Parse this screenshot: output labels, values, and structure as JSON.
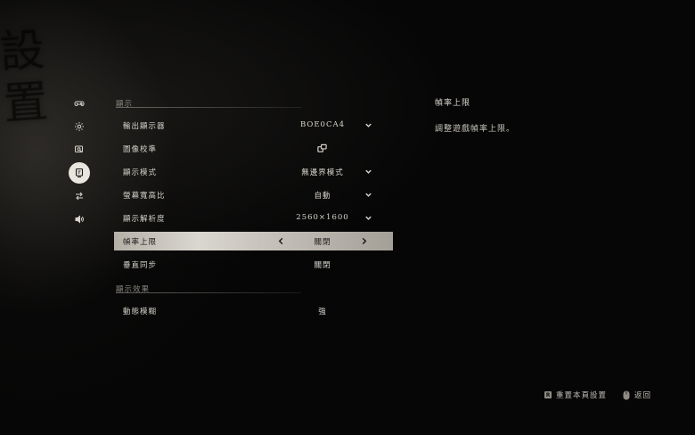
{
  "background_title": "設置",
  "sidebar": {
    "items": [
      {
        "icon": "gamepad-icon",
        "active": false
      },
      {
        "icon": "gear-icon",
        "active": false
      },
      {
        "icon": "magnify-screen-icon",
        "active": false
      },
      {
        "icon": "monitor-icon",
        "active": true
      },
      {
        "icon": "swap-arrows-icon",
        "active": false
      },
      {
        "icon": "speaker-icon",
        "active": false
      }
    ]
  },
  "sections": [
    {
      "title": "顯示"
    },
    {
      "title": "顯示效果"
    }
  ],
  "settings": [
    {
      "label": "輸出顯示器",
      "value": "BOE0CA4",
      "control": "dropdown"
    },
    {
      "label": "圖像校準",
      "value": "",
      "control": "external-link"
    },
    {
      "label": "顯示模式",
      "value": "無邊界模式",
      "control": "dropdown"
    },
    {
      "label": "螢幕寬高比",
      "value": "自動",
      "control": "dropdown"
    },
    {
      "label": "顯示解析度",
      "value": "2560×1600",
      "control": "dropdown"
    },
    {
      "label": "幀率上限",
      "value": "關閉",
      "control": "selector",
      "selected": true
    },
    {
      "label": "垂直同步",
      "value": "關閉",
      "control": "toggle"
    },
    {
      "label": "動態模糊",
      "value": "強",
      "control": "toggle"
    }
  ],
  "description": {
    "title": "幀率上限",
    "text": "調整遊戲幀率上限。"
  },
  "hints": {
    "reset_key": "R",
    "reset_label": "重置本頁設置",
    "back_label": "返回"
  },
  "colors": {
    "highlight": "#dedbd4",
    "text": "#d8d4cc",
    "background": "#060606"
  }
}
